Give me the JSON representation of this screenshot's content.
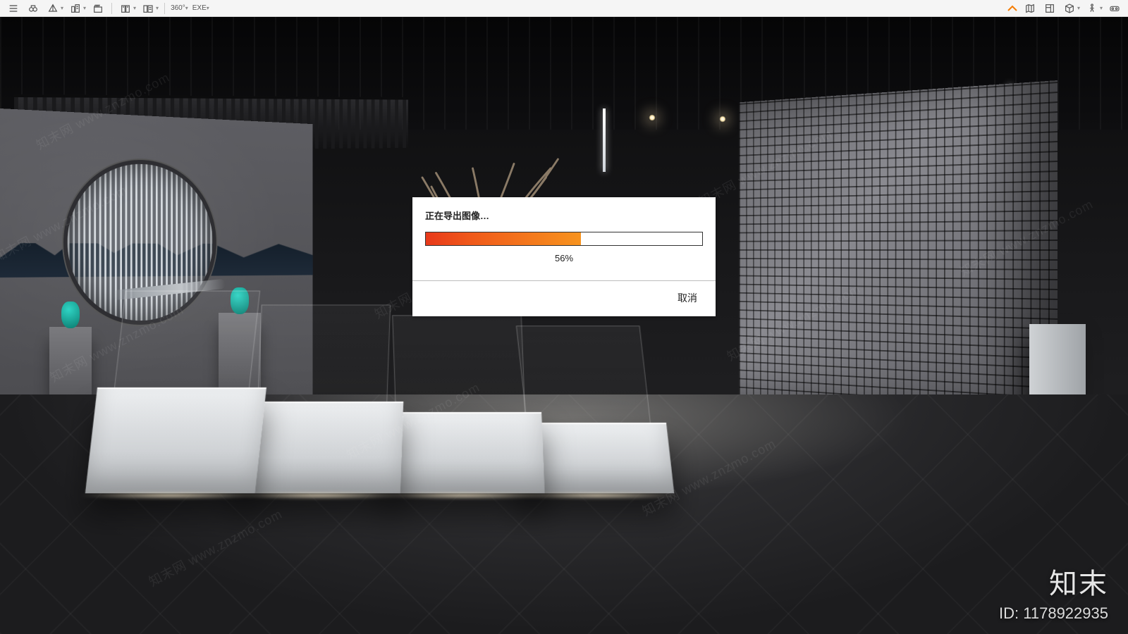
{
  "toolbar": {
    "left_buttons": [
      {
        "name": "menu-icon"
      },
      {
        "name": "binoculars-icon"
      },
      {
        "name": "pyramid-icon",
        "has_dropdown": true
      },
      {
        "name": "buildings-icon",
        "has_dropdown": true
      },
      {
        "name": "clapper-icon"
      }
    ],
    "left_buttons_group2": [
      {
        "name": "library-a-icon",
        "has_dropdown": true
      },
      {
        "name": "library-b-icon",
        "has_dropdown": true
      }
    ],
    "badge_360": "360°",
    "exe_label": "EXE",
    "right_buttons": [
      {
        "name": "map-icon"
      },
      {
        "name": "blueprint-icon"
      },
      {
        "name": "cube-icon",
        "has_dropdown": true
      },
      {
        "name": "walk-icon",
        "has_dropdown": true
      },
      {
        "name": "vr-icon"
      }
    ]
  },
  "dialog": {
    "title": "正在导出图像…",
    "percent_value": 56,
    "percent_text": "56%",
    "cancel_label": "取消"
  },
  "branding": {
    "logo_text": "知末",
    "id_prefix": "ID: ",
    "id_value": "1178922935"
  },
  "watermark": {
    "text": "知末网 www.znzmo.com"
  },
  "colors": {
    "accent": "#f7931e",
    "progress_start": "#e8391a",
    "progress_end": "#f7931e"
  }
}
